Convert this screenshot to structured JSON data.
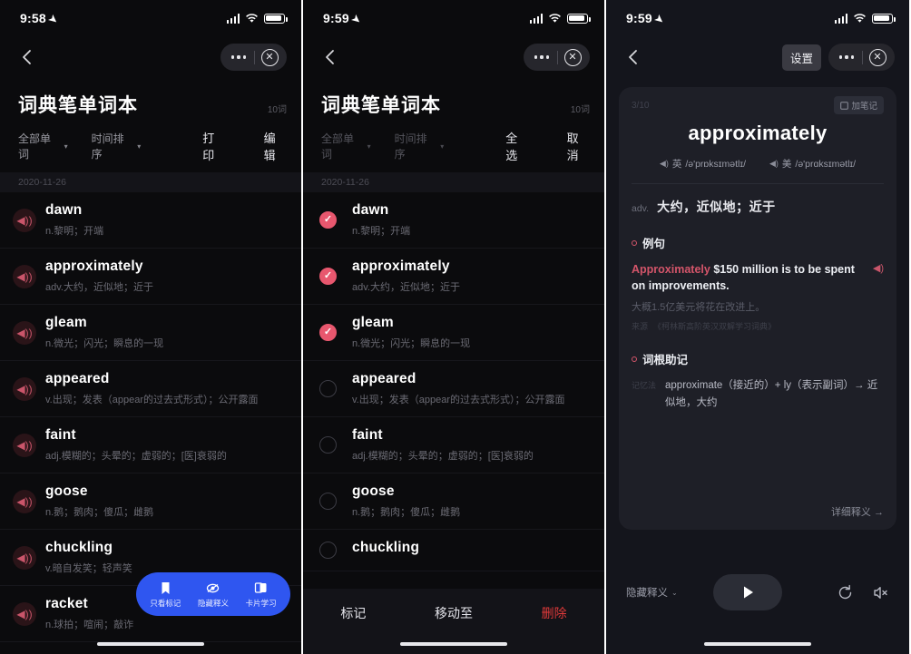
{
  "panel1": {
    "status": {
      "time": "9:58",
      "location_icon": "location-arrow-icon",
      "signal_icon": "cellular-signal-icon",
      "wifi_icon": "wifi-icon",
      "battery_icon": "battery-full-icon"
    },
    "nav": {
      "back_icon": "chevron-left-icon",
      "more_icon": "more-dots-icon",
      "close_icon": "close-circle-icon"
    },
    "title": "词典笔单词本",
    "word_count": "10词",
    "filters": [
      {
        "label": "全部单词",
        "caret": "▾"
      },
      {
        "label": "时间排序",
        "caret": "▾"
      }
    ],
    "actions": [
      "打印",
      "编辑"
    ],
    "date": "2020-11-26",
    "words": [
      {
        "word": "dawn",
        "def": "n.黎明；开端"
      },
      {
        "word": "approximately",
        "def": "adv.大约，近似地；近于"
      },
      {
        "word": "gleam",
        "def": "n.微光；闪光；瞬息的一现"
      },
      {
        "word": "appeared",
        "def": "v.出现；发表（appear的过去式形式）；公开露面"
      },
      {
        "word": "faint",
        "def": "adj.模糊的；头晕的；虚弱的；[医]衰弱的"
      },
      {
        "word": "goose",
        "def": "n.鹅；鹅肉；傻瓜；雌鹅"
      },
      {
        "word": "chuckling",
        "def": "v.暗自发笑；轻声笑"
      },
      {
        "word": "racket",
        "def": "n.球拍；喧闹；敲诈"
      }
    ],
    "fab": [
      {
        "icon": "bookmark-icon",
        "label": "只看标记"
      },
      {
        "icon": "hide-eye-icon",
        "label": "隐藏释义"
      },
      {
        "icon": "flashcard-icon",
        "label": "卡片学习"
      }
    ],
    "accent_blue": "#2f56f0",
    "speaker_icon": "speaker-icon"
  },
  "panel2": {
    "status": {
      "time": "9:59"
    },
    "title": "词典笔单词本",
    "word_count": "10词",
    "filters": [
      {
        "label": "全部单词",
        "caret": "▾"
      },
      {
        "label": "时间排序",
        "caret": "▾"
      }
    ],
    "actions": [
      "全选",
      "取消"
    ],
    "date": "2020-11-26",
    "words": [
      {
        "word": "dawn",
        "def": "n.黎明；开端",
        "checked": true
      },
      {
        "word": "approximately",
        "def": "adv.大约，近似地；近于",
        "checked": true
      },
      {
        "word": "gleam",
        "def": "n.微光；闪光；瞬息的一现",
        "checked": true
      },
      {
        "word": "appeared",
        "def": "v.出现；发表（appear的过去式形式）；公开露面",
        "checked": false
      },
      {
        "word": "faint",
        "def": "adj.模糊的；头晕的；虚弱的；[医]衰弱的",
        "checked": false
      },
      {
        "word": "goose",
        "def": "n.鹅；鹅肉；傻瓜；雌鹅",
        "checked": false
      },
      {
        "word": "chuckling",
        "def": "",
        "checked": false
      }
    ],
    "bottom_actions": [
      {
        "label": "标记",
        "danger": false
      },
      {
        "label": "移动至",
        "danger": false
      },
      {
        "label": "删除",
        "danger": true
      }
    ],
    "check_color": "#e8576e",
    "danger_color": "#e03a3a"
  },
  "panel3": {
    "status": {
      "time": "9:59"
    },
    "nav": {
      "settings_label": "设置",
      "more_icon": "more-dots-icon",
      "close_icon": "close-circle-icon"
    },
    "card": {
      "index": "3/10",
      "note_badge": "加笔记",
      "headword": "approximately",
      "phonetics": [
        {
          "region": "英",
          "ipa": "/ə'prɒksɪmətlɪ/"
        },
        {
          "region": "美",
          "ipa": "/ə'prɑksɪmətlɪ/"
        }
      ],
      "pos": "adv.",
      "meaning": "大约，近似地；近于",
      "example_section_title": "例句",
      "example_en_highlight": "Approximately",
      "example_en_rest": " $150 million is to be spent on improvements.",
      "example_cn": "大概1.5亿美元将花在改进上。",
      "example_source_tag": "来源",
      "example_source": "《柯林斯高阶英汉双解学习词典》",
      "root_section_title": "词根助记",
      "root_tag": "记忆法",
      "root_text": "approximate（接近的）+ ly（表示副词）→ 近似地，大约",
      "detail_link": "详细释义 →"
    },
    "controls": {
      "hide_def": "隐藏释义",
      "hide_def_caret": "⌄",
      "play_icon": "play-icon",
      "refresh_icon": "refresh-icon",
      "mute_icon": "speaker-mute-icon"
    },
    "accent_red": "#d4556a"
  }
}
